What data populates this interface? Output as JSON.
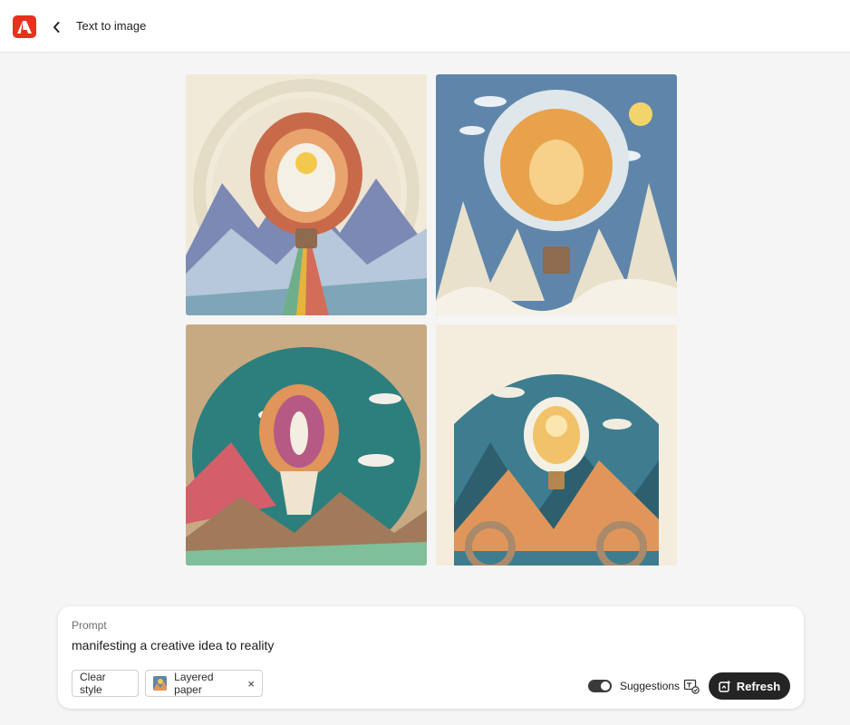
{
  "header": {
    "title": "Text to image",
    "logo_icon": "adobe-firefly-logo-icon",
    "back_icon": "chevron-left-icon"
  },
  "gallery": {
    "images": [
      {
        "name": "generated-image-1",
        "palette": [
          "#f1ead8",
          "#c86a4a",
          "#6f8cb0",
          "#e9b949"
        ]
      },
      {
        "name": "generated-image-2",
        "palette": [
          "#5f86aa",
          "#e9e1cc",
          "#e8a24c",
          "#f2c94c"
        ]
      },
      {
        "name": "generated-image-3",
        "palette": [
          "#c8aa82",
          "#2d7f7e",
          "#e0955a",
          "#d45f6a"
        ]
      },
      {
        "name": "generated-image-4",
        "palette": [
          "#f4ecdc",
          "#3d7d8f",
          "#e0965b",
          "#f2c26a"
        ]
      }
    ]
  },
  "prompt": {
    "label": "Prompt",
    "text": "manifesting a creative idea to reality",
    "clear_style": "Clear style",
    "style_chip": "Layered paper",
    "style_remove": "×",
    "suggestions_label": "Suggestions",
    "suggestions_on": true,
    "refresh": "Refresh"
  },
  "colors": {
    "brand": "#e8301c",
    "button_dark": "#242424"
  }
}
